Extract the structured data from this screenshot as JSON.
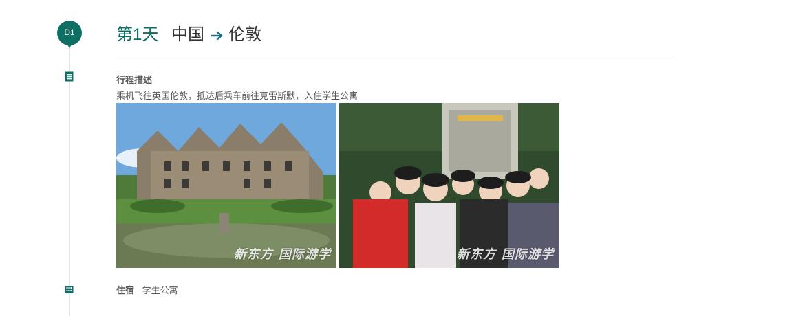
{
  "day": {
    "badge": "D1",
    "number_label": "第1天",
    "from": "中国",
    "to": "伦敦"
  },
  "itinerary": {
    "heading": "行程描述",
    "description": "乘机飞往英国伦敦，抵达后乘车前往克雷斯默，入住学生公寓"
  },
  "photos": [
    {
      "watermark_main": "新东方",
      "watermark_sub": "国际游学"
    },
    {
      "watermark_main": "新东方",
      "watermark_sub": "国际游学"
    }
  ],
  "accommodation": {
    "label": "住宿",
    "value": "学生公寓"
  },
  "colors": {
    "accent": "#0e6f64",
    "divider": "#e3e3e3",
    "timeline": "#e6e6e6"
  },
  "icons": [
    "plane-icon",
    "document-icon",
    "building-icon"
  ]
}
